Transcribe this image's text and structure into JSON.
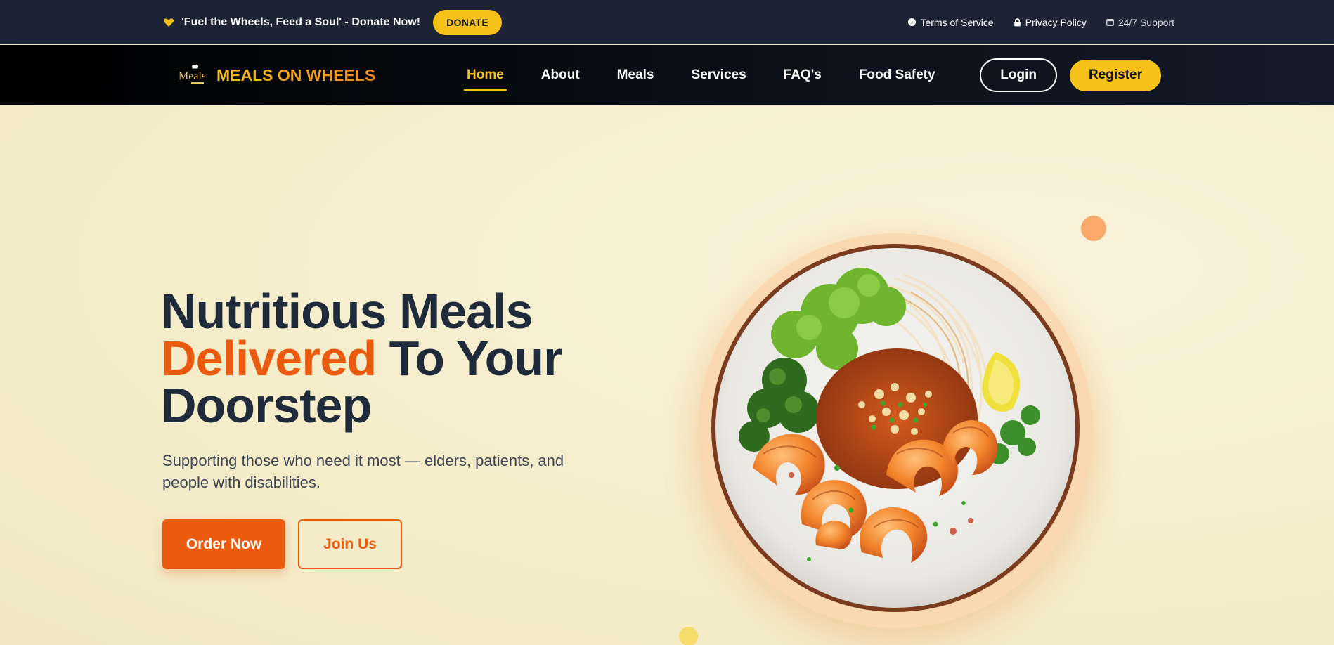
{
  "topbar": {
    "message": "'Fuel the Wheels, Feed a Soul' - Donate Now!",
    "donate_label": "DONATE",
    "links": [
      {
        "label": "Terms of Service",
        "icon": "info-icon"
      },
      {
        "label": "Privacy Policy",
        "icon": "lock-icon"
      },
      {
        "label": "24/7 Support",
        "icon": "calendar-icon"
      }
    ]
  },
  "navbar": {
    "brand_name": "MEALS ON WHEELS",
    "logo_text": "Meals",
    "links": [
      "Home",
      "About",
      "Meals",
      "Services",
      "FAQ's",
      "Food Safety"
    ],
    "active_link": "Home",
    "login_label": "Login",
    "register_label": "Register"
  },
  "hero": {
    "headline_line1": "Nutritious Meals",
    "headline_accent": "Delivered",
    "headline_line2_rest": " To Your",
    "headline_line3": "Doorstep",
    "subtext": "Supporting those who need it most — elders, patients, and people with disabilities.",
    "order_label": "Order Now",
    "join_label": "Join Us"
  },
  "colors": {
    "accent_orange": "#ea5b10",
    "brand_yellow": "#f6c21a",
    "topbar_bg": "#1d2435",
    "hero_bg": "#f5eccc",
    "headline": "#1f2a3b"
  }
}
